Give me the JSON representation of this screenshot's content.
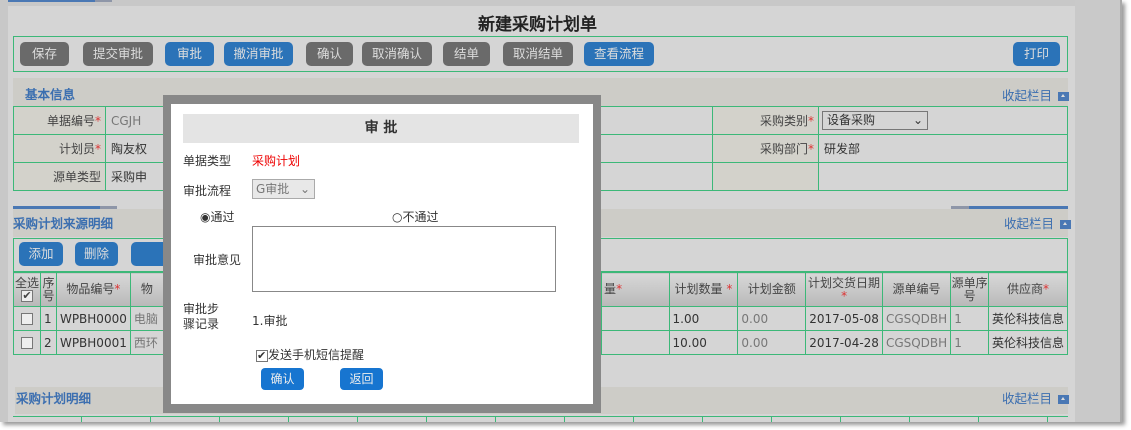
{
  "title": "新建采购计划单",
  "toolbar": [
    {
      "label": "保存",
      "style": "gray"
    },
    {
      "label": "提交审批",
      "style": "gray"
    },
    {
      "label": "审批",
      "style": "blue"
    },
    {
      "label": "撤消审批",
      "style": "blue"
    },
    {
      "label": "确认",
      "style": "gray"
    },
    {
      "label": "取消确认",
      "style": "gray"
    },
    {
      "label": "结单",
      "style": "gray"
    },
    {
      "label": "取消结单",
      "style": "gray"
    },
    {
      "label": "查看流程",
      "style": "blue"
    }
  ],
  "print_label": "打印",
  "basic": {
    "title": "基本信息",
    "collapse": "收起栏目",
    "doc_no_label": "单据编号",
    "doc_no": "CGJH",
    "planner_label": "计划员",
    "planner": "陶友权",
    "src_type_label": "源单类型",
    "src_type": "采购申",
    "category_label": "采购类别",
    "category": "设备采购",
    "dept_label": "采购部门",
    "dept": "研发部"
  },
  "source": {
    "title": "采购计划来源明细",
    "collapse": "收起栏目",
    "add": "添加",
    "del": "删除",
    "headers": {
      "select_all": "全选",
      "seq": "序号",
      "item_no": "物品编号",
      "item_name": "物",
      "qty": "量",
      "plan_qty": "计划数量",
      "plan_amt": "计划金额",
      "delivery": "计划交货日期",
      "src_no": "源单编号",
      "src_seq": "源单序号",
      "supplier": "供应商"
    },
    "rows": [
      {
        "seq": "1",
        "item_no": "WPBH0000",
        "item_name": "电脑",
        "plan_qty": "1.00",
        "plan_amt": "0.00",
        "delivery": "2017-05-08",
        "src_no": "CGSQDBH",
        "src_seq": "1",
        "supplier": "英伦科技信息"
      },
      {
        "seq": "2",
        "item_no": "WPBH0001",
        "item_name": "西环",
        "plan_qty": "10.00",
        "plan_amt": "0.00",
        "delivery": "2017-04-28",
        "src_no": "CGSQDBH",
        "src_seq": "1",
        "supplier": "英伦科技信息"
      }
    ]
  },
  "detail": {
    "title": "采购计划明细",
    "collapse": "收起栏目"
  },
  "modal": {
    "title": "审 批",
    "doc_type_label": "单据类型",
    "doc_type": "采购计划",
    "flow_label": "审批流程",
    "flow": "G审批",
    "pass": "通过",
    "reject": "不通过",
    "selected": "通过",
    "opinion_label": "审批意见",
    "opinion": "",
    "steps_label": "审批步骤记录",
    "steps": "1.审批",
    "sms_label": "发送手机短信提醒",
    "sms_checked": true,
    "confirm": "确认",
    "back": "返回"
  },
  "colors": {
    "accent": "#2b73b8",
    "border": "#3cb878",
    "required": "#dd3333"
  }
}
